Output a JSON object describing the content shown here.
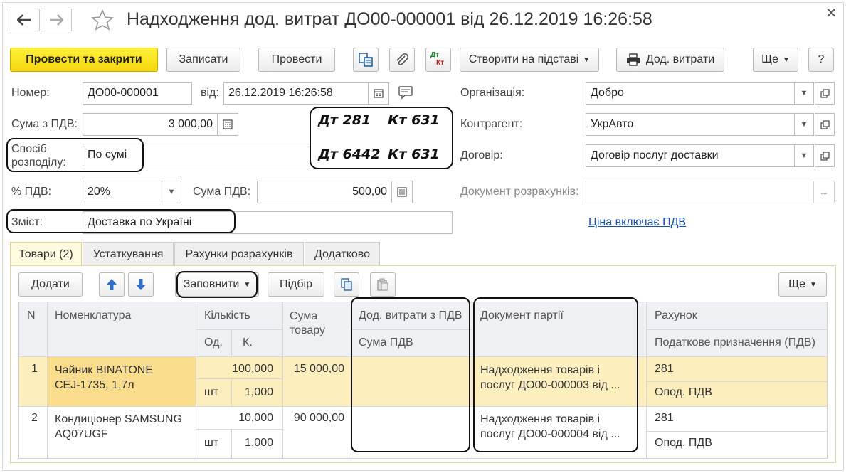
{
  "window": {
    "title": "Надходження дод. витрат ДО00-000001 від 26.12.2019 16:26:58"
  },
  "toolbar": {
    "post_close": "Провести та закрити",
    "save": "Записати",
    "post": "Провести",
    "create_based": "Створити на підставі",
    "add_costs": "Дод. витрати",
    "more": "Ще",
    "help": "?",
    "dtkt_dt": "Дт",
    "dtkt_kt": "Кт"
  },
  "form": {
    "number_label": "Номер:",
    "number_value": "ДО00-000001",
    "date_label": "від:",
    "date_value": "26.12.2019 16:26:58",
    "sum_vat_label": "Сума з ПДВ:",
    "sum_vat_value": "3 000,00",
    "distribution_label_1": "Спосіб",
    "distribution_label_2": "розподілу:",
    "distribution_value": "По сумі",
    "vat_pct_label": "% ПДВ:",
    "vat_pct_value": "20%",
    "vat_sum_label": "Сума ПДВ:",
    "vat_sum_value": "500,00",
    "content_label": "Зміст:",
    "content_value": "Доставка по Україні",
    "org_label": "Організація:",
    "org_value": "Добро",
    "counterparty_label": "Контрагент:",
    "counterparty_value": "УкрАвто",
    "contract_label": "Договір:",
    "contract_value": "Договір послуг доставки",
    "settlement_doc_label": "Документ розрахунків:",
    "settlement_doc_value": "",
    "price_incl_vat_link": "Ціна включає ПДВ",
    "ellipsis": "..."
  },
  "entries": {
    "line1_dt": "Дт 281",
    "line1_kt": "Кт 631",
    "line2_dt": "Дт 6442",
    "line2_kt": "Кт 631"
  },
  "tabs": [
    "Товари (2)",
    "Устаткування",
    "Рахунки розрахунків",
    "Додатково"
  ],
  "grid_toolbar": {
    "add": "Додати",
    "fill": "Заповнити",
    "pick": "Підбір",
    "more": "Ще"
  },
  "grid": {
    "headers": {
      "n": "N",
      "item": "Номенклатура",
      "qty": "Кількість",
      "unit": "Од.",
      "k": "К.",
      "sum_1": "Сума",
      "sum_2": "товару",
      "add_costs": "Дод. витрати з ПДВ",
      "vat_sum": "Сума ПДВ",
      "batch_doc": "Документ партії",
      "account": "Рахунок",
      "tax_purpose": "Податкове призначення (ПДВ)"
    },
    "rows": [
      {
        "n": "1",
        "item_1": "Чайник BINATONE",
        "item_2": "CEJ-1735,  1,7л",
        "qty": "100,000",
        "unit": "шт",
        "k": "1,000",
        "sum": "15 000,00",
        "doc_1": "Надходження товарів і",
        "doc_2": "послуг ДО00-000003 від ...",
        "account": "281",
        "tax": "Опод. ПДВ"
      },
      {
        "n": "2",
        "item_1": "Кондиціонер SAMSUNG",
        "item_2": "AQ07UGF",
        "qty": "10,000",
        "unit": "шт",
        "k": "1,000",
        "sum": "90 000,00",
        "doc_1": "Надходження товарів і",
        "doc_2": "послуг ДО00-000004 від ...",
        "account": "281",
        "tax": "Опод. ПДВ"
      }
    ]
  },
  "colors": {
    "primary_button": "#f5d70d",
    "selected_row": "#fcefbd",
    "selected_cell": "#f9dc8c",
    "link": "#1a4fa8"
  }
}
